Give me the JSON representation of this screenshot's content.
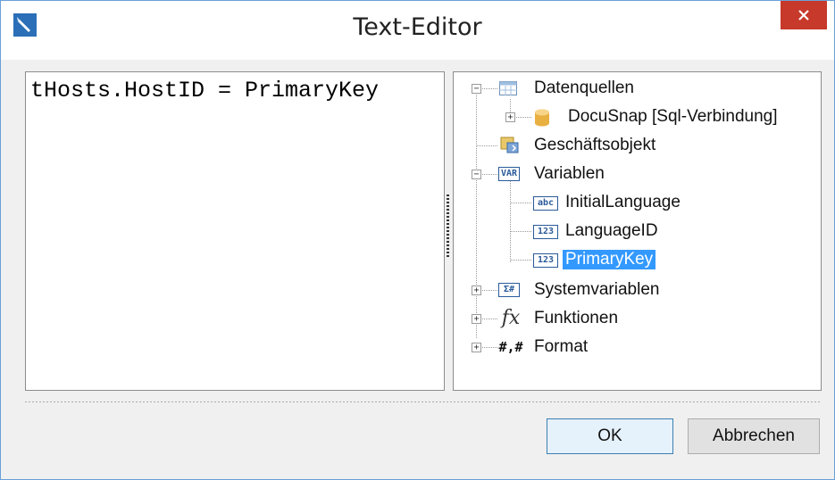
{
  "window": {
    "title": "Text-Editor"
  },
  "editor": {
    "content": "tHosts.HostID = PrimaryKey"
  },
  "tree": {
    "datenquellen": "Datenquellen",
    "docusnap": "DocuSnap [Sql-Verbindung]",
    "geschaeftsobjekt": "Geschäftsobjekt",
    "variablen": "Variablen",
    "initial_language": "InitialLanguage",
    "language_id": "LanguageID",
    "primary_key": "PrimaryKey",
    "systemvariablen": "Systemvariablen",
    "funktionen": "Funktionen",
    "format": "Format"
  },
  "icons": {
    "var": "VAR",
    "abc": "abc",
    "num": "123",
    "sys": "Σ#",
    "fx": "fx",
    "format": "#,#"
  },
  "buttons": {
    "ok": "OK",
    "cancel": "Abbrechen"
  },
  "colors": {
    "selection": "#3399ff",
    "close": "#c7392b",
    "accent": "#2a6fb7"
  }
}
